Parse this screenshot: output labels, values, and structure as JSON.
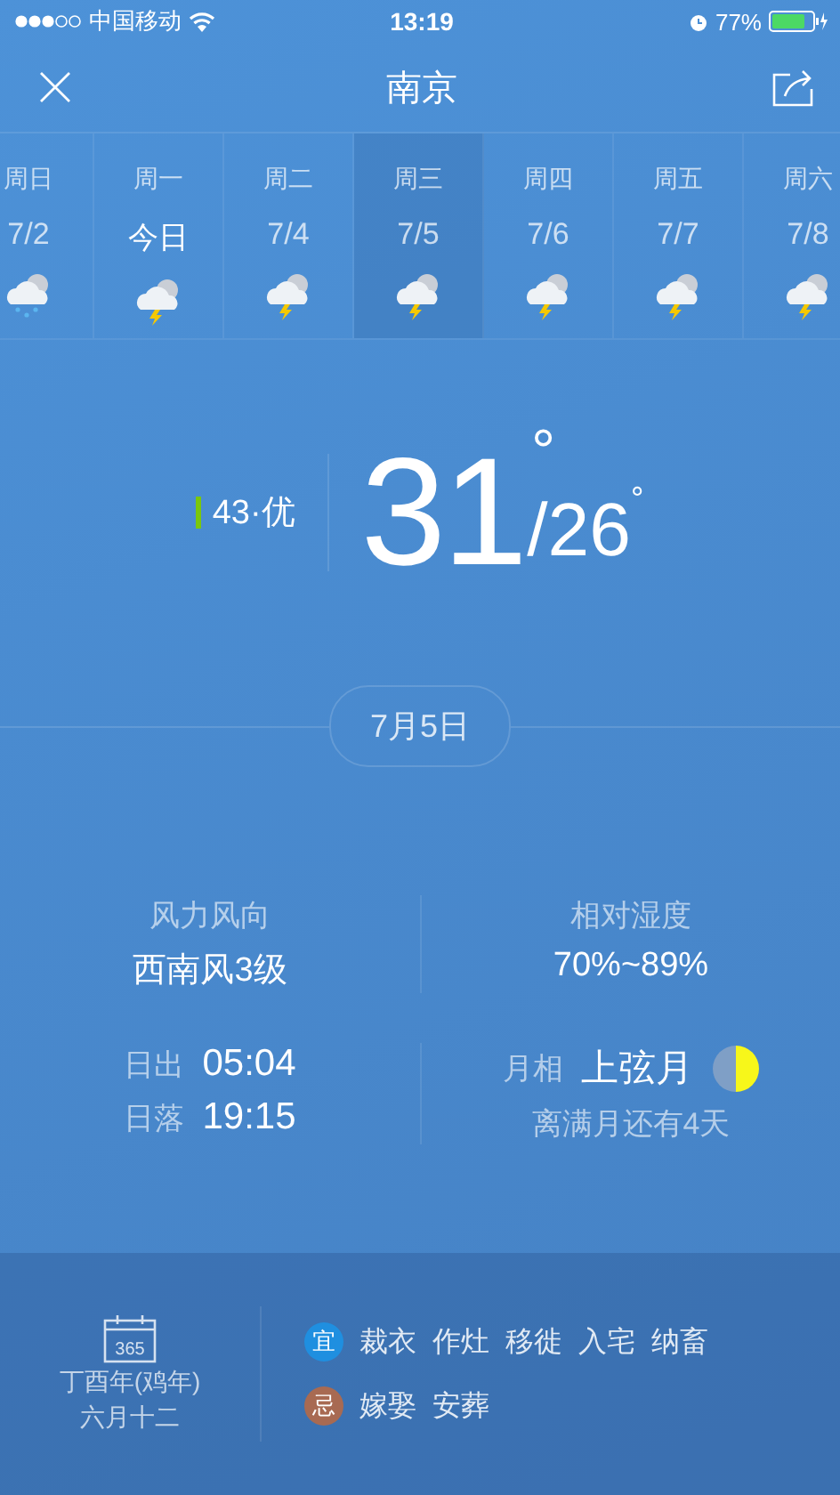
{
  "status_bar": {
    "carrier": "中国移动",
    "time": "13:19",
    "battery": "77%"
  },
  "header": {
    "city": "南京"
  },
  "days": [
    {
      "weekday": "周日",
      "date": "7/2",
      "today": false,
      "selected": false,
      "weather": {
        "kind": "rain"
      }
    },
    {
      "weekday": "周一",
      "date": "今日",
      "today": true,
      "selected": false,
      "weather": {
        "kind": "thunder"
      }
    },
    {
      "weekday": "周二",
      "date": "7/4",
      "today": false,
      "selected": false,
      "weather": {
        "kind": "thunder"
      }
    },
    {
      "weekday": "周三",
      "date": "7/5",
      "today": false,
      "selected": true,
      "weather": {
        "kind": "thunder"
      }
    },
    {
      "weekday": "周四",
      "date": "7/6",
      "today": false,
      "selected": false,
      "weather": {
        "kind": "thunder"
      }
    },
    {
      "weekday": "周五",
      "date": "7/7",
      "today": false,
      "selected": false,
      "weather": {
        "kind": "thunder"
      }
    },
    {
      "weekday": "周六",
      "date": "7/8",
      "today": false,
      "selected": false,
      "weather": {
        "kind": "thunder"
      }
    }
  ],
  "air_quality": {
    "reading": "43·优",
    "color": "#7ac70c"
  },
  "temperature": {
    "high": "31",
    "high_unit": "°",
    "low": "/26",
    "low_unit": "°"
  },
  "date_pill": "7月5日",
  "details": {
    "wind_label": "风力风向",
    "wind_value": "西南风3级",
    "humidity_label": "相对湿度",
    "humidity_value": "70%~89%",
    "sunrise_label": "日出",
    "sunrise": "05:04",
    "sunset_label": "日落",
    "sunset": "19:15",
    "moon_label": "月相",
    "moon_phase": "上弦月",
    "moon_note": "离满月还有4天"
  },
  "almanac": {
    "calendar_icon_text": "365",
    "lunar_year": "丁酉年(鸡年)",
    "lunar_date": "六月十二",
    "rows": [
      {
        "tag": "宜",
        "color": "#1f8fe0",
        "items": [
          "裁衣",
          "作灶",
          "移徙",
          "入宅",
          "纳畜"
        ]
      },
      {
        "tag": "忌",
        "color": "#a86a52",
        "items": [
          "嫁娶",
          "安葬"
        ]
      }
    ]
  }
}
